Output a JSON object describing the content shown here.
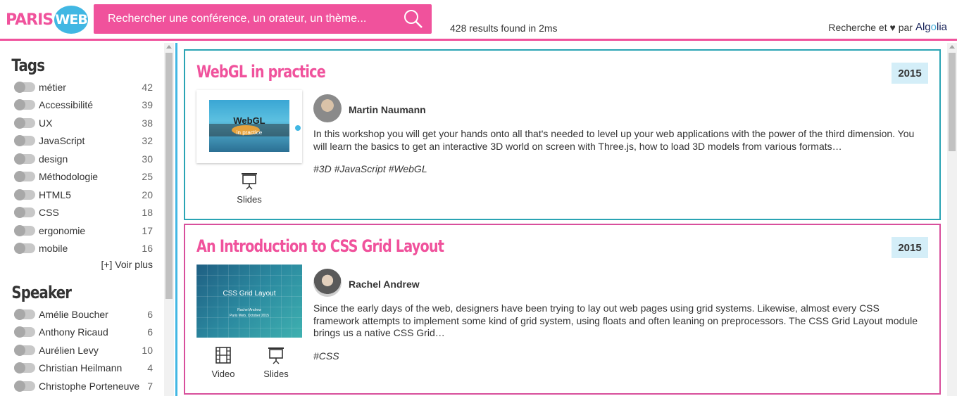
{
  "header": {
    "logo_left": "PARIS",
    "logo_right": "WEB",
    "search_placeholder": "Rechercher une conférence, un orateur, un thème...",
    "results_text": "428 results found in 2ms",
    "powered_text": "Recherche et ♥ par",
    "powered_brand_a": "Alg",
    "powered_brand_o": "o",
    "powered_brand_b": "lia"
  },
  "colors": {
    "brand_pink": "#f0529c",
    "brand_blue": "#41b7e3",
    "year_badge": "#d4eef8"
  },
  "sidebar": {
    "tags_title": "Tags",
    "tags": [
      {
        "label": "métier",
        "count": "42"
      },
      {
        "label": "Accessibilité",
        "count": "39"
      },
      {
        "label": "UX",
        "count": "38"
      },
      {
        "label": "JavaScript",
        "count": "32"
      },
      {
        "label": "design",
        "count": "30"
      },
      {
        "label": "Méthodologie",
        "count": "25"
      },
      {
        "label": "HTML5",
        "count": "20"
      },
      {
        "label": "CSS",
        "count": "18"
      },
      {
        "label": "ergonomie",
        "count": "17"
      },
      {
        "label": "mobile",
        "count": "16"
      }
    ],
    "voir_plus": "[+] Voir plus",
    "speaker_title": "Speaker",
    "speakers": [
      {
        "label": "Amélie Boucher",
        "count": "6"
      },
      {
        "label": "Anthony Ricaud",
        "count": "6"
      },
      {
        "label": "Aurélien Levy",
        "count": "10"
      },
      {
        "label": "Christian Heilmann",
        "count": "4"
      },
      {
        "label": "Christophe Porteneuve",
        "count": "7"
      }
    ]
  },
  "results": [
    {
      "title": "WebGL in practice",
      "year": "2015",
      "thumb_title": "WebGL",
      "thumb_sub": "in practice",
      "speaker": "Martin Naumann",
      "description": "In this workshop you will get your hands onto all that's needed to level up your web applications with the power of the third dimension. You will learn the basics to get an interactive 3D world on screen with Three.js, how to load 3D models from various formats…",
      "tags": "#3D #JavaScript #WebGL",
      "slides_label": "Slides"
    },
    {
      "title": "An Introduction to CSS Grid Layout",
      "year": "2015",
      "thumb_title": "CSS Grid Layout",
      "thumb_author": "Rachel Andrew",
      "thumb_date": "Paris Web, October 2015",
      "speaker": "Rachel Andrew",
      "description": "Since the early days of the web, designers have been trying to lay out web pages using grid systems. Likewise, almost every CSS framework attempts to implement some kind of grid system, using floats and often leaning on preprocessors. The CSS Grid Layout module brings us a native CSS Grid…",
      "tags": "#CSS",
      "video_label": "Video",
      "slides_label": "Slides"
    }
  ]
}
